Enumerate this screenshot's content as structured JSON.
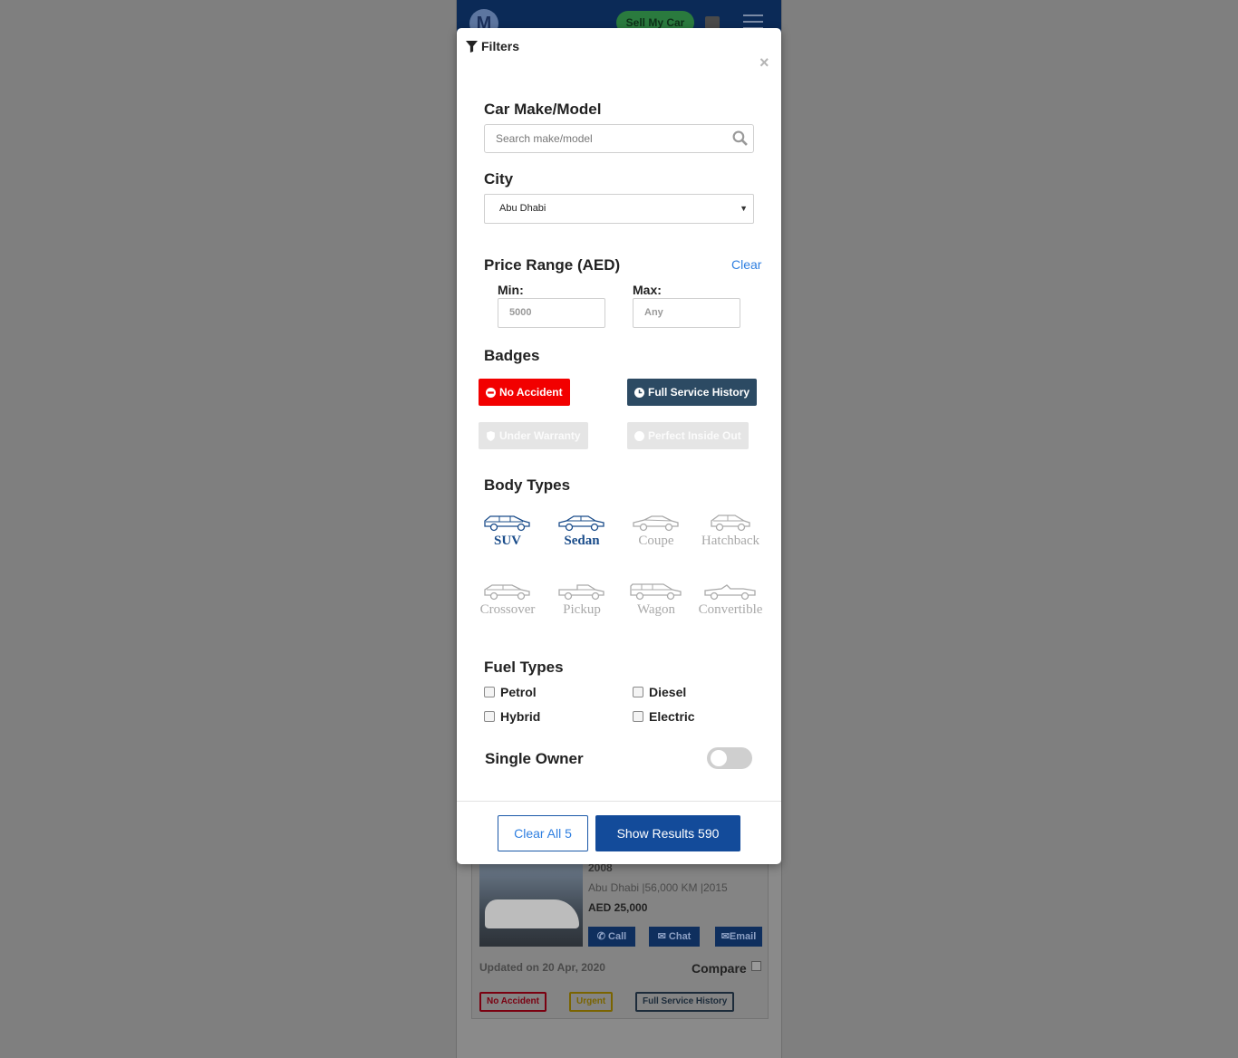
{
  "background": {
    "sell_button": "Sell My Car",
    "logo_letter": "M",
    "listing": {
      "title": "2008",
      "city": "Abu Dhabi",
      "km": "56,000 KM",
      "year": "2015",
      "price": "AED 25,000",
      "call": "Call",
      "chat": "Chat",
      "email": "Email",
      "updated": "Updated on 20 Apr, 2020",
      "compare": "Compare",
      "badges": [
        "No Accident",
        "Urgent",
        "Full Service History"
      ]
    }
  },
  "modal": {
    "title": "Filters",
    "close": "×",
    "make_model": {
      "title": "Car Make/Model",
      "placeholder": "Search make/model"
    },
    "city": {
      "title": "City",
      "selected": "Abu Dhabi"
    },
    "price": {
      "title": "Price Range (AED)",
      "clear": "Clear",
      "min_label": "Min:",
      "max_label": "Max:",
      "min_value": "5000",
      "max_value": "Any"
    },
    "badges": {
      "title": "Badges",
      "items": [
        {
          "label": "No Accident",
          "active": true
        },
        {
          "label": "Full Service History",
          "active": true
        },
        {
          "label": "Under Warranty",
          "active": false
        },
        {
          "label": "Perfect Inside Out",
          "active": false
        }
      ]
    },
    "body_types": {
      "title": "Body Types",
      "items": [
        {
          "label": "SUV",
          "active": true
        },
        {
          "label": "Sedan",
          "active": true
        },
        {
          "label": "Coupe",
          "active": false
        },
        {
          "label": "Hatchback",
          "active": false
        },
        {
          "label": "Crossover",
          "active": false
        },
        {
          "label": "Pickup",
          "active": false
        },
        {
          "label": "Wagon",
          "active": false
        },
        {
          "label": "Convertible",
          "active": false
        }
      ]
    },
    "fuel_types": {
      "title": "Fuel Types",
      "items": [
        "Petrol",
        "Diesel",
        "Hybrid",
        "Electric"
      ]
    },
    "single_owner": {
      "label": "Single Owner",
      "enabled": false
    },
    "footer": {
      "clear_all": "Clear All 5",
      "show_results": "Show Results 590"
    }
  },
  "colors": {
    "accent_blue": "#134b9a",
    "link_blue": "#2f7fe0",
    "badge_red": "#f20000",
    "badge_navy": "#2c4a63"
  }
}
